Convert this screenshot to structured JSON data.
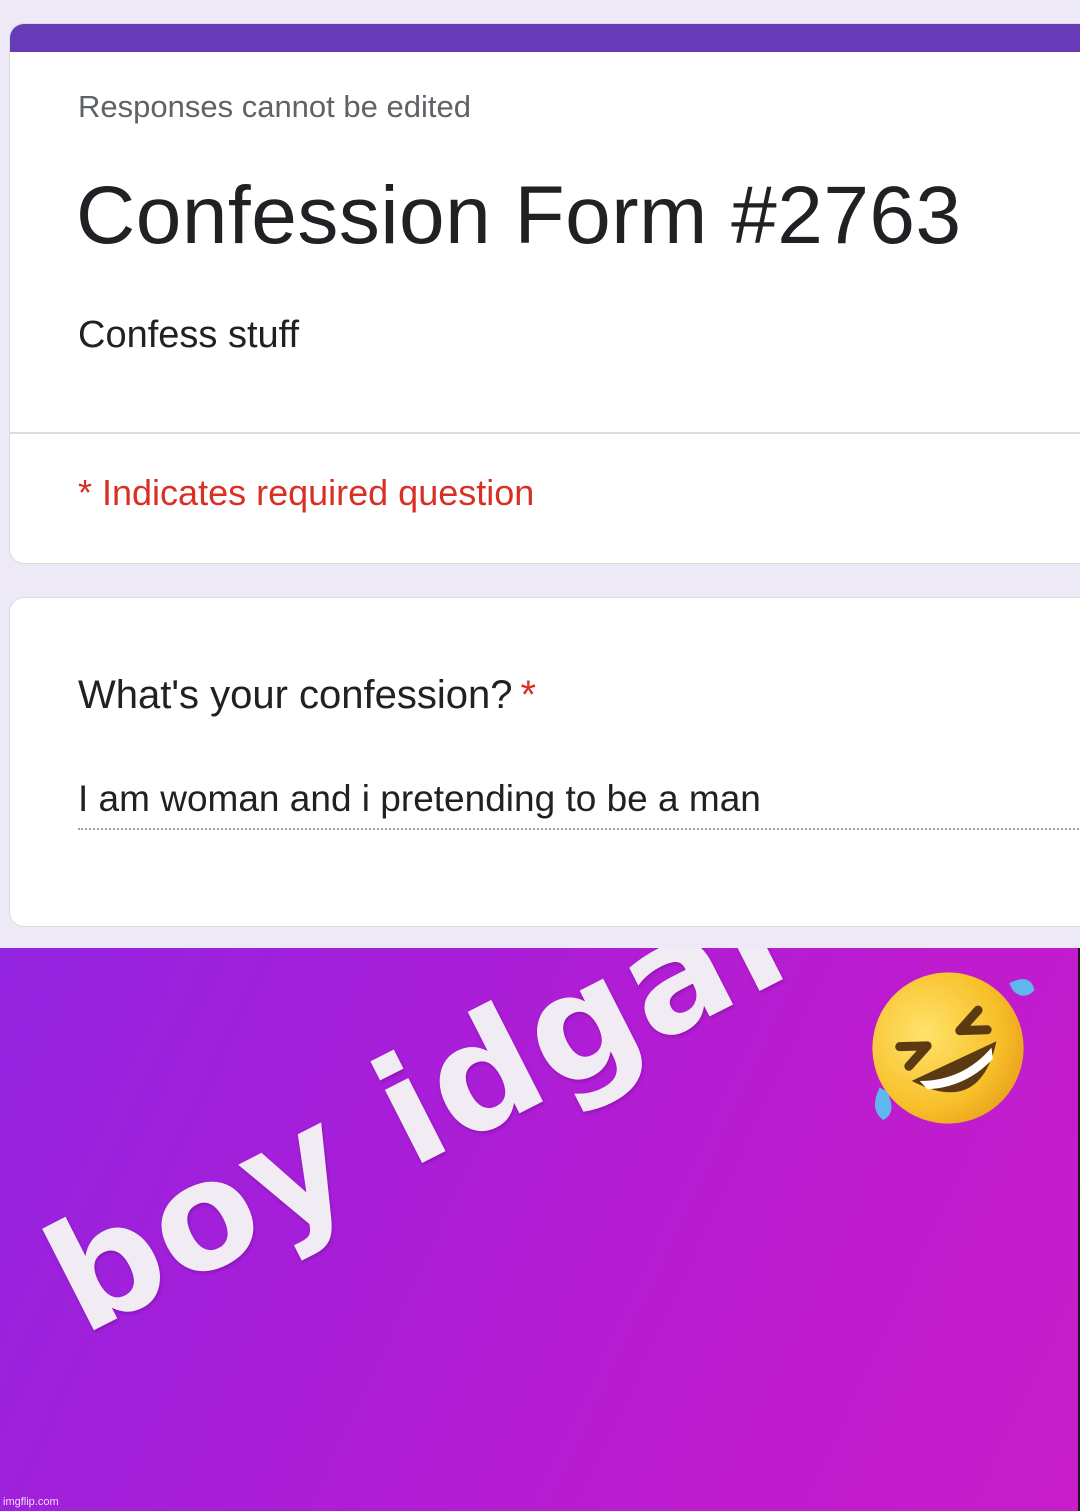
{
  "form": {
    "notice": "Responses cannot be edited",
    "title": "Confession Form #2763",
    "description": "Confess stuff",
    "required_note": "* Indicates required question",
    "accent_color": "#673ab7",
    "required_color": "#d93025"
  },
  "question": {
    "label": "What's your confession?",
    "required_mark": "*",
    "answer": "I am woman and i pretending to be a man"
  },
  "meme": {
    "caption": "boy idgaf",
    "emoji_icon": "rolling-on-floor-laughing-icon",
    "watermark": "imgflip.com"
  }
}
